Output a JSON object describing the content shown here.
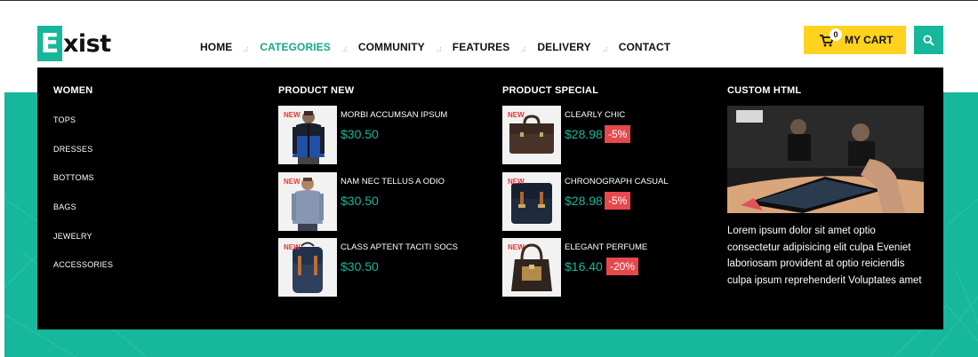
{
  "logo": {
    "letter": "E",
    "rest": "xist"
  },
  "nav": [
    {
      "label": "HOME",
      "active": false
    },
    {
      "label": "CATEGORIES",
      "active": true
    },
    {
      "label": "COMMUNITY",
      "active": false
    },
    {
      "label": "FEATURES",
      "active": false
    },
    {
      "label": "DELIVERY",
      "active": false
    },
    {
      "label": "CONTACT",
      "active": false
    }
  ],
  "cart": {
    "count": "0",
    "label": "MY CART"
  },
  "colors": {
    "accent": "#17b79b",
    "cart": "#ffd21f",
    "discount": "#e5484d",
    "new": "#e53935"
  },
  "menu": {
    "women": {
      "title": "WOMEN",
      "links": [
        "TOPS",
        "DRESSES",
        "BOTTOMS",
        "BAGS",
        "JEWELRY",
        "ACCESSORIES"
      ]
    },
    "product_new": {
      "title": "PRODUCT NEW",
      "items": [
        {
          "badge": "NEW",
          "name": "MORBI ACCUMSAN IPSUM",
          "price": "$30.50",
          "image": "jacket-man"
        },
        {
          "badge": "NEW",
          "name": "NAM NEC TELLUS A ODIO",
          "price": "$30.50",
          "image": "shirt-man"
        },
        {
          "badge": "NEW",
          "name": "CLASS APTENT TACITI SOCS",
          "price": "$30.50",
          "image": "backpack"
        }
      ]
    },
    "product_special": {
      "title": "PRODUCT SPECIAL",
      "items": [
        {
          "badge": "NEW",
          "name": "CLEARLY CHIC",
          "price": "$28.98",
          "discount": "-5%",
          "image": "briefcase"
        },
        {
          "badge": "NEW",
          "name": "CHRONOGRAPH CASUAL",
          "price": "$28.98",
          "discount": "-5%",
          "image": "navy-backpack"
        },
        {
          "badge": "NEW",
          "name": "ELEGANT PERFUME",
          "price": "$16.40",
          "discount": "-20%",
          "image": "handbag"
        }
      ]
    },
    "custom_html": {
      "title": "CUSTOM HTML",
      "image": "tablet-photo",
      "text": "Lorem ipsum dolor sit amet optio consectetur adipisicing elit culpa Eveniet laboriosam provident at optio reiciendis culpa ipsum reprehenderit Voluptates amet"
    }
  }
}
